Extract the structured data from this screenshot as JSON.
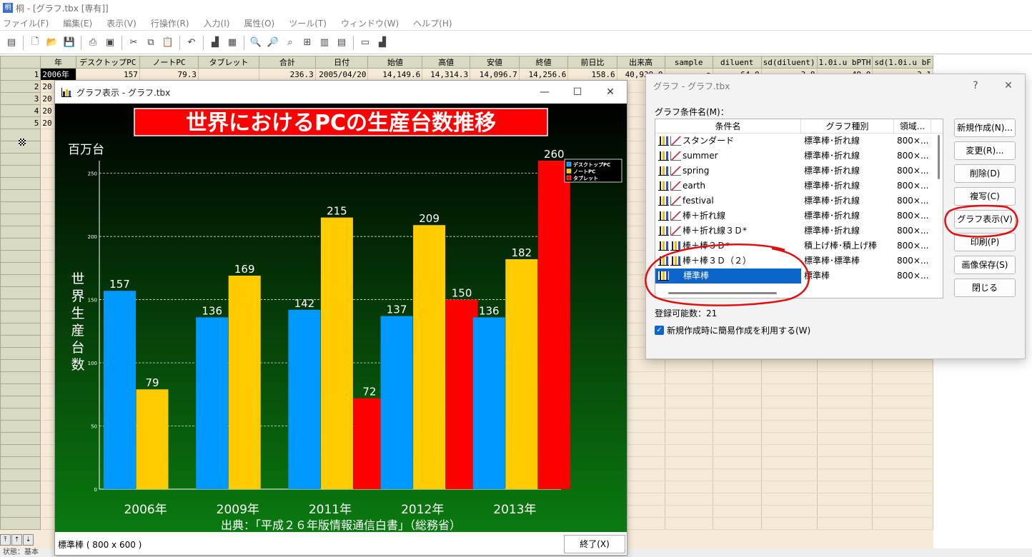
{
  "window": {
    "title": "桐 - [グラフ.tbx [専有]]"
  },
  "menu": [
    "ファイル(F)",
    "編集(E)",
    "表示(V)",
    "行操作(R)",
    "入力(I)",
    "属性(O)",
    "ツール(T)",
    "ウィンドウ(W)",
    "ヘルプ(H)"
  ],
  "grid": {
    "columns": [
      "年",
      "デスクトップPC",
      "ノートPC",
      "タブレット",
      "合計",
      "日付",
      "始値",
      "高値",
      "安値",
      "終値",
      "前日比",
      "出来高",
      "sample",
      "diluent",
      "sd(diluent)",
      "1.0i.u bPTH",
      "sd(1.0i.u bF"
    ],
    "rows": [
      {
        "n": "1",
        "cells": [
          "2006年",
          "157",
          "79.3",
          "",
          "236.3",
          "2005/04/20",
          "14,149.6",
          "14,314.3",
          "14,096.7",
          "14,256.6",
          "158.6",
          "40,939.0",
          "a",
          "64.0",
          "3.8",
          "49.0",
          "3.1"
        ]
      },
      {
        "n": "2",
        "cells": [
          "20"
        ]
      },
      {
        "n": "3",
        "cells": [
          "20"
        ]
      },
      {
        "n": "4",
        "cells": [
          "20"
        ]
      },
      {
        "n": "5",
        "cells": [
          "20"
        ]
      }
    ],
    "partial_right": [
      "9",
      "2",
      "8"
    ]
  },
  "graph_window": {
    "title": "グラフ表示 - グラフ.tbx",
    "footer_label": "標準棒 ( 800 x 600 )",
    "end_button": "終了(X)",
    "controls": {
      "min": "—",
      "max": "☐",
      "close": "✕"
    }
  },
  "chart_data": {
    "type": "bar",
    "title": "世界におけるPCの生産台数推移",
    "unit_label": "百万台",
    "ylabel": "世界生産台数",
    "source": "出典：「平成２６年版情報通信白書」（総務省）",
    "categories": [
      "2006年",
      "2009年",
      "2011年",
      "2012年",
      "2013年"
    ],
    "series": [
      {
        "name": "デスクトップPC",
        "color": "#0099ff",
        "values": [
          157,
          136,
          142,
          137,
          136
        ]
      },
      {
        "name": "ノートPC",
        "color": "#ffcc00",
        "values": [
          79,
          169,
          215,
          209,
          182
        ]
      },
      {
        "name": "タブレット",
        "color": "#ff0000",
        "values": [
          null,
          null,
          72,
          150,
          260
        ]
      }
    ],
    "yticks": [
      "0",
      "50",
      "100",
      "150",
      "200",
      "250"
    ],
    "ylim": [
      0,
      260
    ],
    "grid": true,
    "legend": "top-right",
    "background": [
      "#000000",
      "#0a7a10"
    ]
  },
  "dialog": {
    "title": "グラフ - グラフ.tbx",
    "help": "?",
    "close": "✕",
    "list_label": "グラフ条件名(M)：",
    "headers": [
      "条件名",
      "グラフ種別",
      "領域..."
    ],
    "items": [
      {
        "name": "スタンダード",
        "kind": "標準棒･折れ線",
        "area": "800×..."
      },
      {
        "name": "summer",
        "kind": "標準棒･折れ線",
        "area": "800×..."
      },
      {
        "name": "spring",
        "kind": "標準棒･折れ線",
        "area": "800×..."
      },
      {
        "name": "earth",
        "kind": "標準棒･折れ線",
        "area": "800×..."
      },
      {
        "name": "festival",
        "kind": "標準棒･折れ線",
        "area": "800×..."
      },
      {
        "name": "棒＋折れ線",
        "kind": "標準棒･折れ線",
        "area": "800×..."
      },
      {
        "name": "棒＋折れ線３Ｄ*",
        "kind": "標準棒･折れ線",
        "area": "800×..."
      },
      {
        "name": "棒＋棒３Ｄ*",
        "kind": "積上げ棒･積上げ棒",
        "area": "800×..."
      },
      {
        "name": "棒＋棒３Ｄ（２）",
        "kind": "標準棒･標準棒",
        "area": "800×..."
      },
      {
        "name": "標準棒",
        "kind": "標準棒",
        "area": "800×..."
      }
    ],
    "buttons": [
      "新規作成(N)...",
      "変更(R)...",
      "削除(D)",
      "複写(C)",
      "グラフ表示(V)",
      "印刷(P)",
      "画像保存(S)",
      "閉じる"
    ],
    "count_label": "登録可能数：21",
    "checkbox_label": "新規作成時に簡易作成を利用する(W)"
  },
  "status": {
    "text": "状態：基本"
  },
  "annotation_color": "#e01010"
}
